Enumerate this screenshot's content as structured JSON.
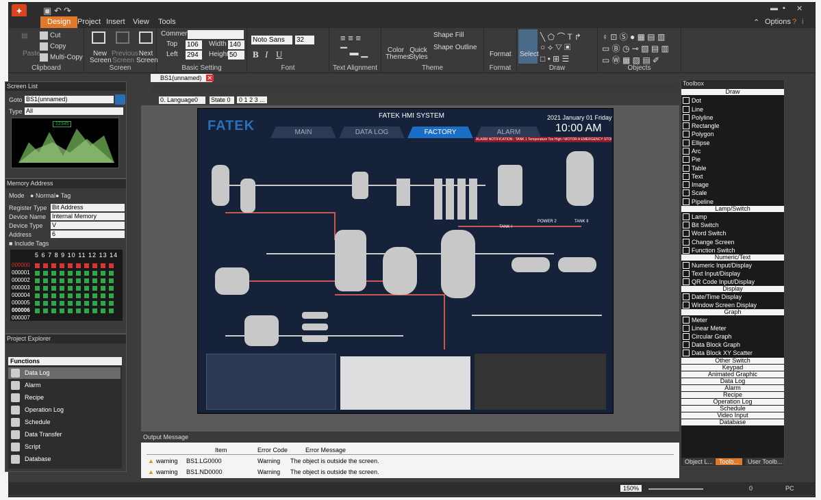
{
  "menus": [
    "Design",
    "Project",
    "Insert",
    "View",
    "Tools"
  ],
  "options_label": "Options",
  "ribbon": {
    "clipboard": {
      "paste": "Paste",
      "cut": "Cut",
      "copy": "Copy",
      "multi_copy": "Multi-Copy",
      "label": "Clipboard"
    },
    "screen": {
      "new": "New Screen",
      "previous": "Previous Screen",
      "next": "Next Screen",
      "label": "Screen"
    },
    "basic": {
      "comment": "Comment",
      "top": "Top",
      "top_val": "106",
      "left": "Left",
      "left_val": "294",
      "width": "Width",
      "width_val": "140",
      "height": "Height",
      "height_val": "50",
      "label": "Basic Setting"
    },
    "font": {
      "name": "Noto Sans",
      "size": "32",
      "label": "Font"
    },
    "align": {
      "label": "Text Alignment"
    },
    "theme": {
      "color": "Color Themes",
      "quick": "Quick Styles",
      "fill": "Shape Fill",
      "outline": "Shape Outline",
      "label": "Theme"
    },
    "format": {
      "btn": "Format",
      "label": "Format"
    },
    "draw": {
      "select": "Select",
      "label": "Draw"
    },
    "objects": {
      "label": "Objects"
    }
  },
  "screen_list": {
    "title": "Screen List",
    "goto": "Goto",
    "goto_val": "BS1(unnamed)",
    "type": "Type",
    "type_val": "All",
    "thumb_val": "12345"
  },
  "memory": {
    "title": "Memory Address",
    "mode": "Mode",
    "normal": "Normal",
    "tag": "Tag",
    "register_type": "Register Type",
    "register_val": "Bit Address",
    "device_name": "Device Name",
    "device_name_val": "Internal Memory",
    "device_type": "Device Type",
    "device_type_val": "V",
    "address": "Address",
    "address_val": "6",
    "include_tags": "Include Tags",
    "cols": [
      "5",
      "6",
      "7",
      "8",
      "9",
      "10",
      "11",
      "12",
      "13",
      "14"
    ],
    "rows": [
      "000000",
      "000001",
      "000002",
      "000003",
      "000004",
      "000005",
      "000006",
      "000007",
      "000008"
    ]
  },
  "explorer": {
    "title": "Project Explorer",
    "section": "Functions",
    "items": [
      "Data Log",
      "Alarm",
      "Recipe",
      "Operation Log",
      "Schedule",
      "Data Transfer",
      "Script",
      "Database"
    ]
  },
  "doc_tab": "BS1(unnamed)",
  "lang": "0. Language0",
  "state": "State 0",
  "state_nums": [
    "0",
    "1",
    "2",
    "3",
    "..."
  ],
  "hmi": {
    "brand": "FATEK",
    "system": "FATEK HMI SYSTEM",
    "date": "2021 January 01 Friday",
    "time": "10:00 AM",
    "tabs": [
      "MAIN",
      "DATA LOG",
      "FACTORY",
      "ALARM"
    ],
    "alarm": "ALARM NOTIFICATION : TANK 1 Temperature Too High / MOTOR A EMERGENCY STOP",
    "tank1": "TANK I",
    "power2": "POWER 2",
    "tank2": "TANK II"
  },
  "toolbox": {
    "title": "Toolbox",
    "sections": [
      {
        "name": "Draw",
        "items": [
          "Dot",
          "Line",
          "Polyline",
          "Rectangle",
          "Polygon",
          "Ellipse",
          "Arc",
          "Pie",
          "Table",
          "Text",
          "Image",
          "Scale",
          "Pipeline"
        ]
      },
      {
        "name": "Lamp/Switch",
        "items": [
          "Lamp",
          "Bit Switch",
          "Word Switch",
          "Change Screen",
          "Function Switch"
        ]
      },
      {
        "name": "Numeric/Text",
        "items": [
          "Numeric Input/Display",
          "Text Input/Display",
          "QR Code Input/Display"
        ]
      },
      {
        "name": "Display",
        "items": [
          "Date/Time Display",
          "Window Screen Display"
        ]
      },
      {
        "name": "Graph",
        "items": [
          "Meter",
          "Linear Meter",
          "Circular Graph",
          "Data Block Graph",
          "Data Block XY Scatter"
        ]
      }
    ],
    "collapsed": [
      "Other Switch",
      "Keypad",
      "Animated Graphic",
      "Data Log",
      "Alarm",
      "Recipe",
      "Operation Log",
      "Schedule",
      "Video Input",
      "Database"
    ],
    "bottom_tabs": [
      "Object L...",
      "Toolb...",
      "User Toolb..."
    ]
  },
  "output": {
    "title": "Output Message",
    "cols": [
      "Item",
      "Error Code",
      "Error Message"
    ],
    "rows": [
      {
        "level": "warning",
        "item": "BS1.LG0000",
        "code": "Warning",
        "msg": "The object is outside the screen."
      },
      {
        "level": "warning",
        "item": "BS1.ND0000",
        "code": "Warning",
        "msg": "The object is outside the screen."
      }
    ]
  },
  "status": {
    "zoom": "150%",
    "count": "0",
    "mode": "PC"
  }
}
